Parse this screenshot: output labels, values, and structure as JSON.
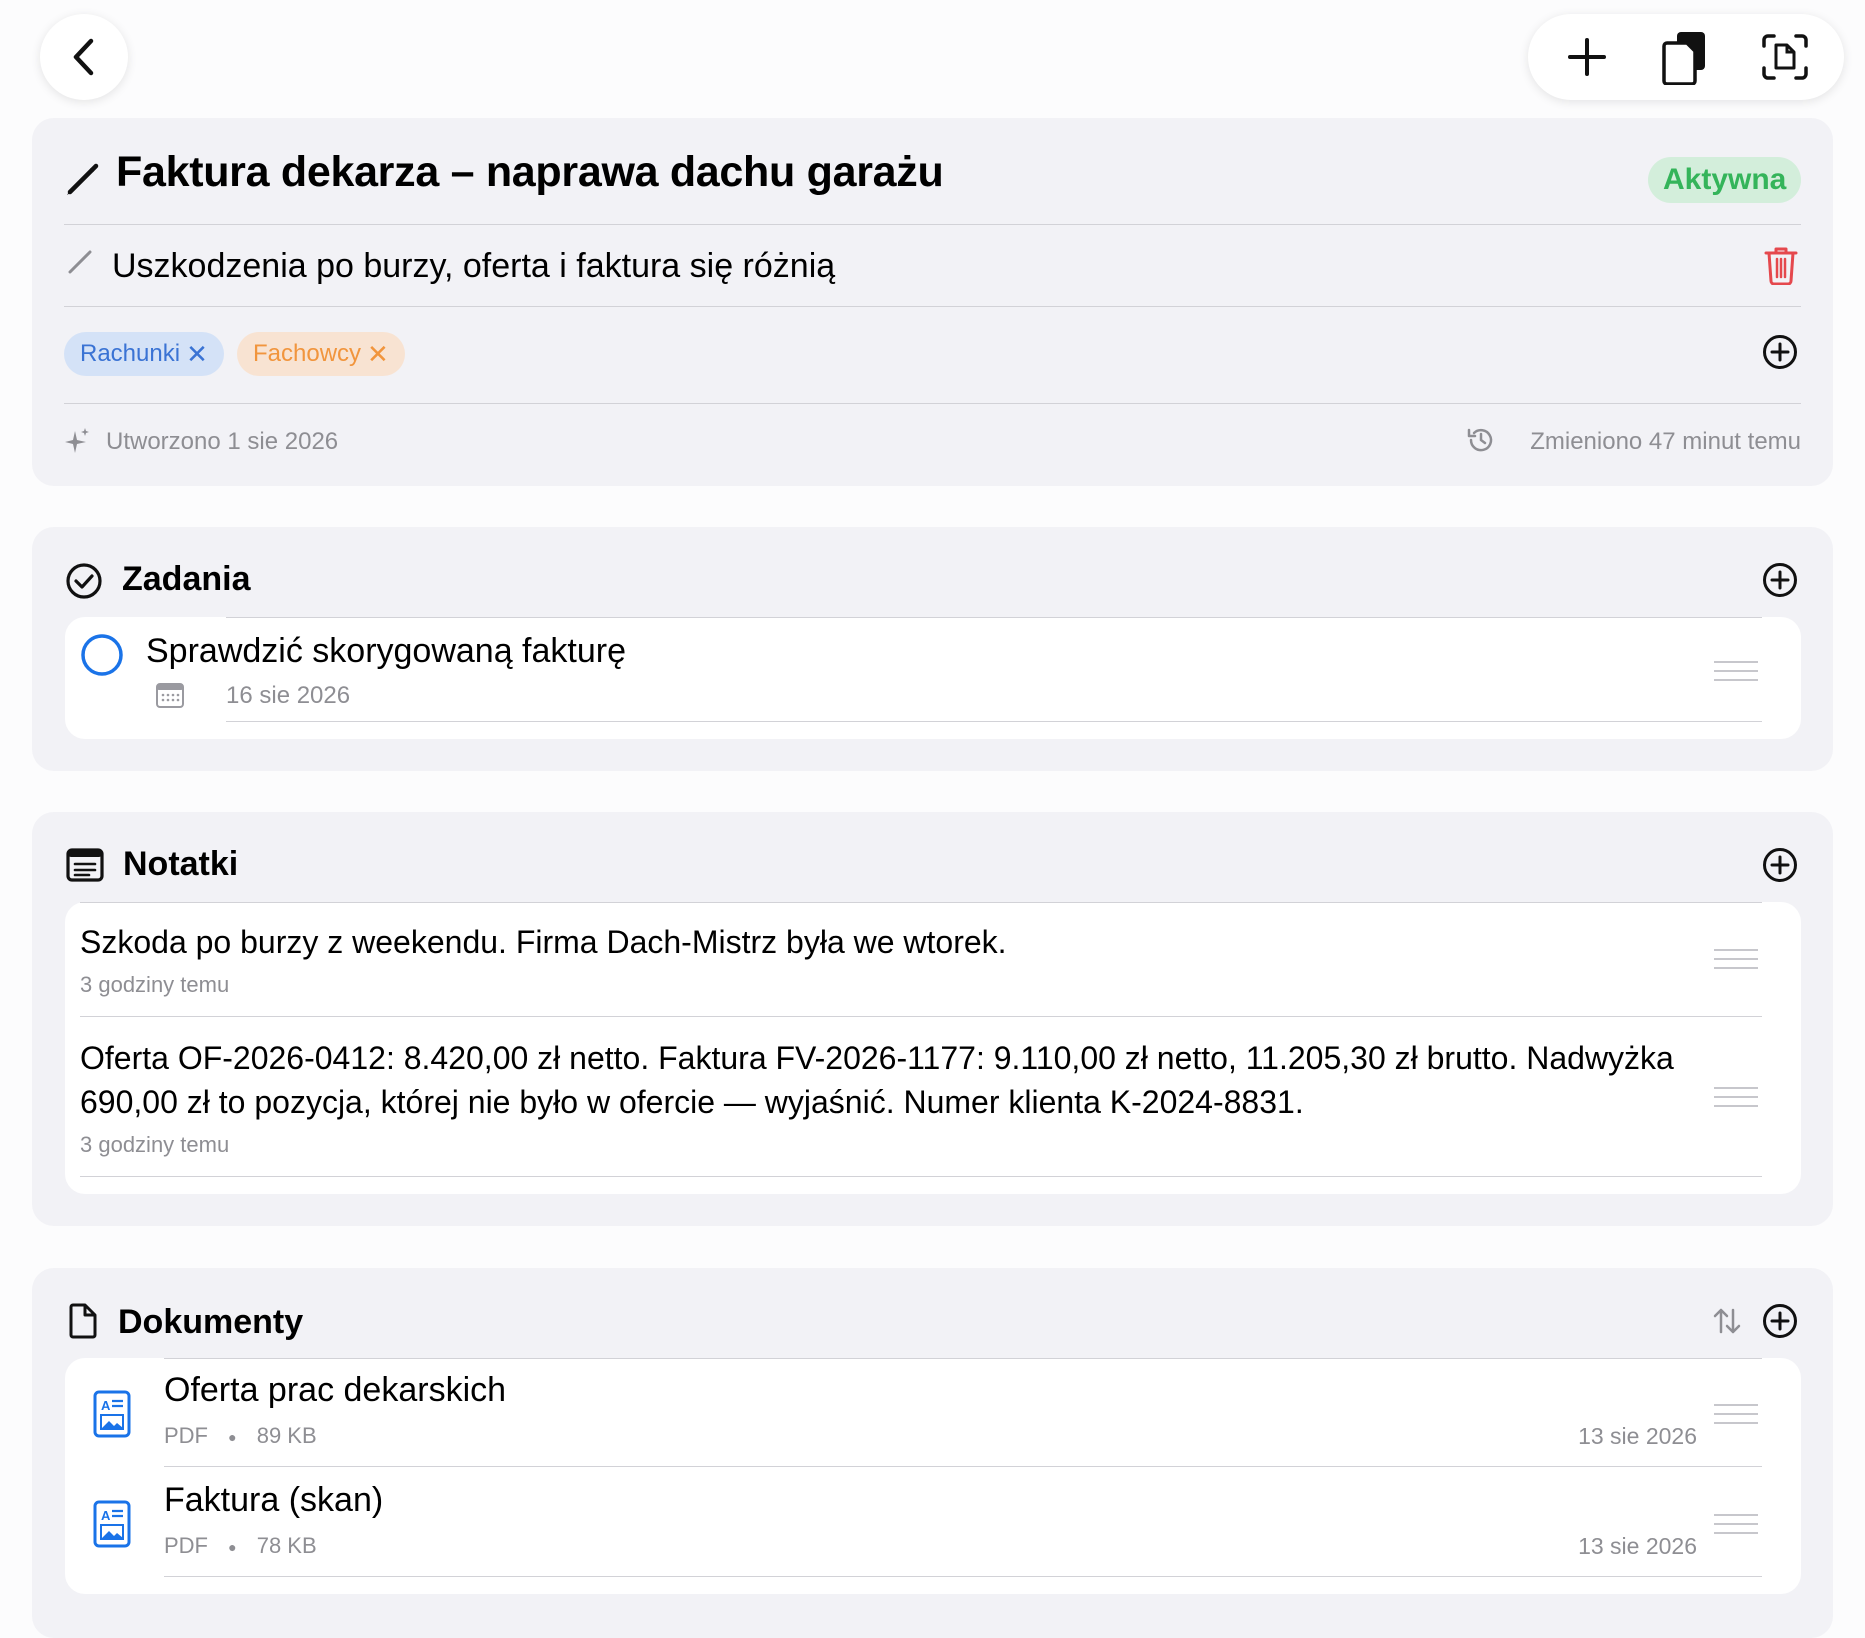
{
  "header": {
    "title": "Faktura dekarza – naprawa dachu garażu",
    "status_badge": "Aktywna",
    "subtitle": "Uszkodzenia po burzy, oferta i faktura się różnią",
    "tags": [
      {
        "label": "Rachunki",
        "color": "#3a73d4"
      },
      {
        "label": "Fachowcy",
        "color": "#f1953d"
      }
    ],
    "created": "Utworzono 1 sie 2026",
    "modified": "Zmieniono 47 minut temu"
  },
  "tasks": {
    "title": "Zadania",
    "items": [
      {
        "label": "Sprawdzić skorygowaną fakturę",
        "date": "16 sie 2026"
      }
    ]
  },
  "notes": {
    "title": "Notatki",
    "items": [
      {
        "text": "Szkoda po burzy z weekendu. Firma Dach-Mistrz była we wtorek.",
        "time": "3 godziny temu"
      },
      {
        "text": "Oferta OF-2026-0412: 8.420,00 zł netto. Faktura FV-2026-1177: 9.110,00 zł netto, 11.205,30 zł brutto. Nadwyżka 690,00 zł to pozycja, której nie było w ofercie — wyjaśnić. Numer klienta K-2024-8831.",
        "time": "3 godziny temu"
      }
    ]
  },
  "documents": {
    "title": "Dokumenty",
    "items": [
      {
        "name": "Oferta prac dekarskich",
        "type": "PDF",
        "size": "89 KB",
        "date": "13 sie 2026"
      },
      {
        "name": "Faktura (skan)",
        "type": "PDF",
        "size": "78 KB",
        "date": "13 sie 2026"
      }
    ]
  },
  "colors": {
    "accent": "#1a73e8",
    "status_green": "#34b45a",
    "delete_red": "#e5484d"
  },
  "icons": [
    "back-chevron-icon",
    "plus-icon",
    "duplicate-icon",
    "scan-document-icon",
    "pencil-icon",
    "trash-icon",
    "add-circle-icon",
    "sparkles-icon",
    "history-icon",
    "checkmark-circle-icon",
    "note-icon",
    "document-icon",
    "sort-icon",
    "calendar-icon",
    "pdf-file-icon",
    "drag-handle-icon"
  ]
}
